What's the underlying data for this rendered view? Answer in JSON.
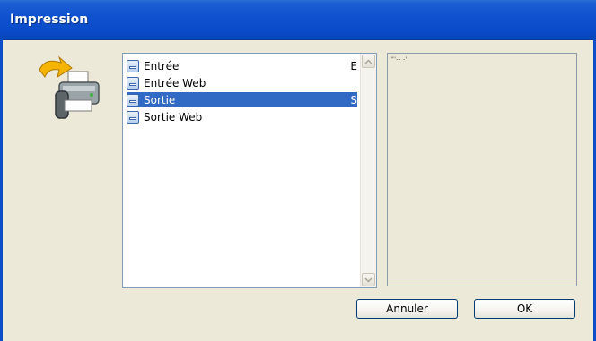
{
  "window": {
    "title": "Impression"
  },
  "list": {
    "items": [
      {
        "label": "Entrée",
        "trail": "E",
        "selected": false
      },
      {
        "label": "Entrée Web",
        "trail": "",
        "selected": false
      },
      {
        "label": "Sortie",
        "trail": "S",
        "selected": true
      },
      {
        "label": "Sortie Web",
        "trail": "",
        "selected": false
      }
    ]
  },
  "preview": {
    "text": "\"'-- -'"
  },
  "buttons": {
    "cancel_label": "Annuler",
    "ok_label": "OK"
  },
  "colors": {
    "titlebar": "#0a4bc8",
    "selection": "#316ac5",
    "dialog_bg": "#ece9d8"
  },
  "icons": {
    "printer": "printer-icon",
    "item": "document-icon"
  }
}
